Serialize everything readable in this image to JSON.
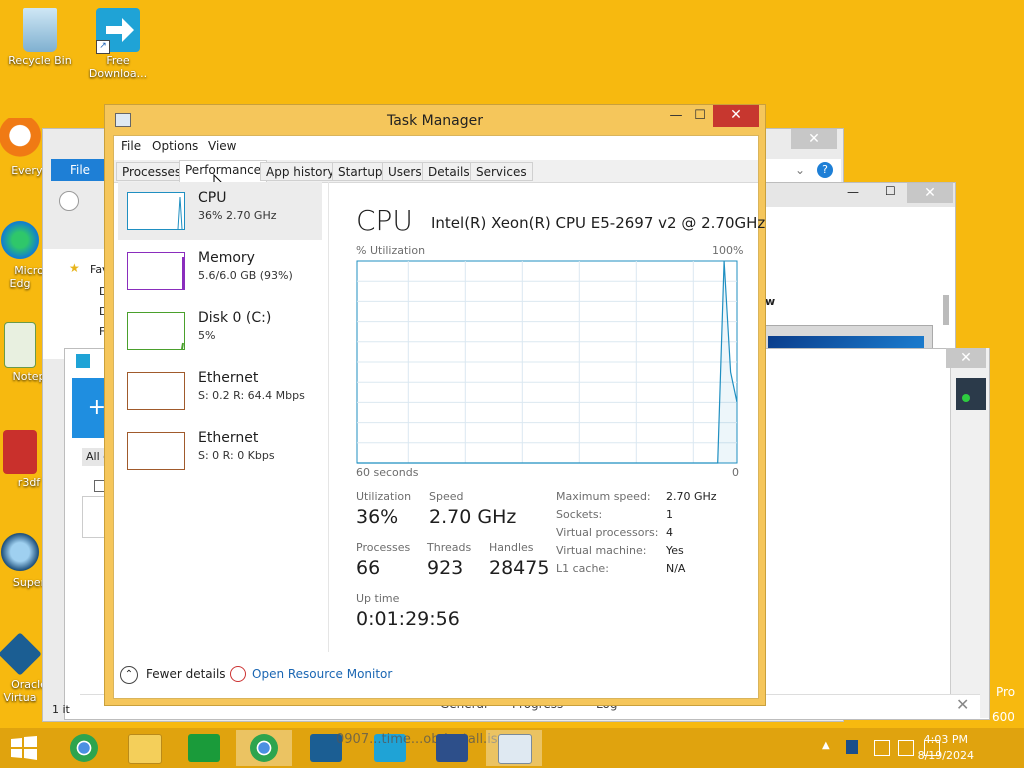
{
  "desktop": {
    "icons": [
      {
        "label": "Recycle Bin",
        "icon": "recycle-bin-icon"
      },
      {
        "label": "Free Downloa...",
        "icon": "free-download-manager-icon"
      },
      {
        "label": "Everyt",
        "icon": "everything-search-icon"
      },
      {
        "label": "Micro Edg",
        "icon": "edge-icon"
      },
      {
        "label": "Notep",
        "icon": "notepad-icon"
      },
      {
        "label": "r3df",
        "icon": "r3d-icon"
      },
      {
        "label": "Super",
        "icon": "super-icon"
      },
      {
        "label": "Oracle Virtua",
        "icon": "virtualbox-icon"
      }
    ]
  },
  "background": {
    "explorer": {
      "file_tab": "File",
      "fav_label": "Fav",
      "nav_letters": [
        "D",
        "D",
        "F"
      ]
    },
    "installer": {
      "all_tab": "All c",
      "status": "1 it"
    },
    "right_window": {
      "heading": "w",
      "pro_label": "Pro",
      "pro_num": "600"
    },
    "bottom_tabs": [
      "General",
      "Progress",
      "Log"
    ],
    "taskbar_text": "0907...time...ob-install.iso"
  },
  "task_manager": {
    "title": "Task Manager",
    "menu": [
      "File",
      "Options",
      "View"
    ],
    "tabs": [
      "Processes",
      "Performance",
      "App history",
      "Startup",
      "Users",
      "Details",
      "Services"
    ],
    "active_tab": "Performance",
    "resources": [
      {
        "name": "CPU",
        "detail": "36%  2.70 GHz",
        "color": "#1f8fc1"
      },
      {
        "name": "Memory",
        "detail": "5.6/6.0 GB (93%)",
        "color": "#8a2dbd"
      },
      {
        "name": "Disk 0 (C:)",
        "detail": "5%",
        "color": "#4aa02c"
      },
      {
        "name": "Ethernet",
        "detail": "S: 0.2  R: 64.4 Mbps",
        "color": "#a05a2c"
      },
      {
        "name": "Ethernet",
        "detail": "S: 0  R: 0 Kbps",
        "color": "#a05a2c"
      }
    ],
    "cpu_panel": {
      "title": "CPU",
      "model": "Intel(R) Xeon(R) CPU E5-2697 v2 @ 2.70GHz",
      "graph_label": "% Utilization",
      "graph_max": "100%",
      "graph_time": "60 seconds",
      "graph_min": "0",
      "stats": {
        "utilization_label": "Utilization",
        "utilization": "36%",
        "speed_label": "Speed",
        "speed": "2.70 GHz",
        "processes_label": "Processes",
        "processes": "66",
        "threads_label": "Threads",
        "threads": "923",
        "handles_label": "Handles",
        "handles": "28475",
        "uptime_label": "Up time",
        "uptime": "0:01:29:56"
      },
      "specs": [
        {
          "label": "Maximum speed:",
          "value": "2.70 GHz"
        },
        {
          "label": "Sockets:",
          "value": "1"
        },
        {
          "label": "Virtual processors:",
          "value": "4"
        },
        {
          "label": "Virtual machine:",
          "value": "Yes"
        },
        {
          "label": "L1 cache:",
          "value": "N/A"
        }
      ]
    },
    "footer": {
      "fewer_details": "Fewer details",
      "resource_monitor": "Open Resource Monitor"
    }
  },
  "taskbar": {
    "clock_time": "4:03 PM",
    "clock_date": "8/19/2024",
    "apps": [
      "chrome-icon",
      "file-explorer-icon",
      "store-icon",
      "chrome-icon",
      "virtualbox-icon",
      "free-download-manager-icon",
      "winaero-8-icon",
      "task-manager-icon"
    ]
  },
  "cpu_graph_series": [
    0,
    0,
    0,
    0,
    0,
    0,
    0,
    0,
    0,
    0,
    0,
    0,
    0,
    0,
    0,
    0,
    0,
    0,
    0,
    0,
    0,
    0,
    0,
    0,
    0,
    0,
    0,
    0,
    0,
    0,
    0,
    0,
    0,
    0,
    0,
    0,
    0,
    0,
    0,
    0,
    0,
    0,
    0,
    0,
    0,
    0,
    0,
    0,
    0,
    0,
    0,
    0,
    0,
    0,
    0,
    0,
    0,
    100,
    45,
    30
  ]
}
